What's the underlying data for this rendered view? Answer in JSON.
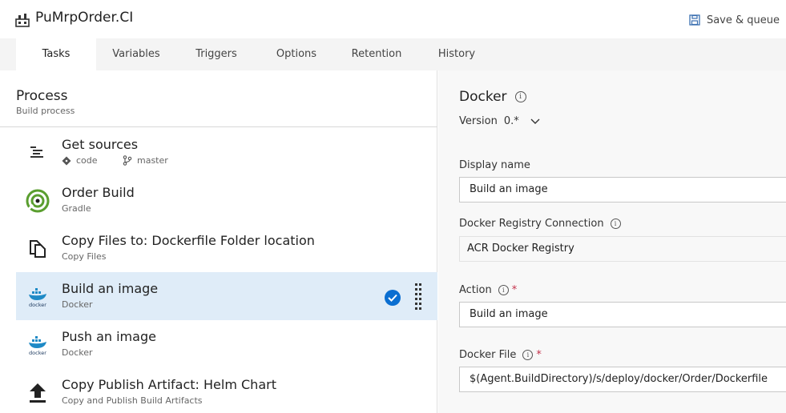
{
  "header": {
    "title": "PuMrpOrder.CI",
    "save_queue_label": "Save & queue"
  },
  "tabs": [
    {
      "label": "Tasks"
    },
    {
      "label": "Variables"
    },
    {
      "label": "Triggers"
    },
    {
      "label": "Options"
    },
    {
      "label": "Retention"
    },
    {
      "label": "History"
    }
  ],
  "process": {
    "title": "Process",
    "subtitle": "Build process"
  },
  "tasks": [
    {
      "name": "Get sources",
      "repo": "code",
      "branch": "master"
    },
    {
      "name": "Order Build",
      "subtitle": "Gradle"
    },
    {
      "name": "Copy Files to: Dockerfile Folder location",
      "subtitle": "Copy Files"
    },
    {
      "name": "Build an image",
      "subtitle": "Docker",
      "icon_text": "docker"
    },
    {
      "name": "Push an image",
      "subtitle": "Docker",
      "icon_text": "docker"
    },
    {
      "name": "Copy Publish Artifact: Helm Chart",
      "subtitle": "Copy and Publish Build Artifacts"
    }
  ],
  "details": {
    "title": "Docker",
    "version_label": "Version",
    "version_value": "0.*",
    "display_name_label": "Display name",
    "display_name_value": "Build an image",
    "registry_label": "Docker Registry Connection",
    "registry_value": "ACR Docker Registry",
    "action_label": "Action",
    "action_value": "Build an image",
    "dockerfile_label": "Docker File",
    "dockerfile_value": "$(Agent.BuildDirectory)/s/deploy/docker/Order/Dockerfile",
    "required_mark": "*"
  },
  "colors": {
    "selected_row": "#dfecf8",
    "accent": "#0a6ed1",
    "gradle_green": "#5a9e2f",
    "docker_blue": "#1f8ac6"
  }
}
